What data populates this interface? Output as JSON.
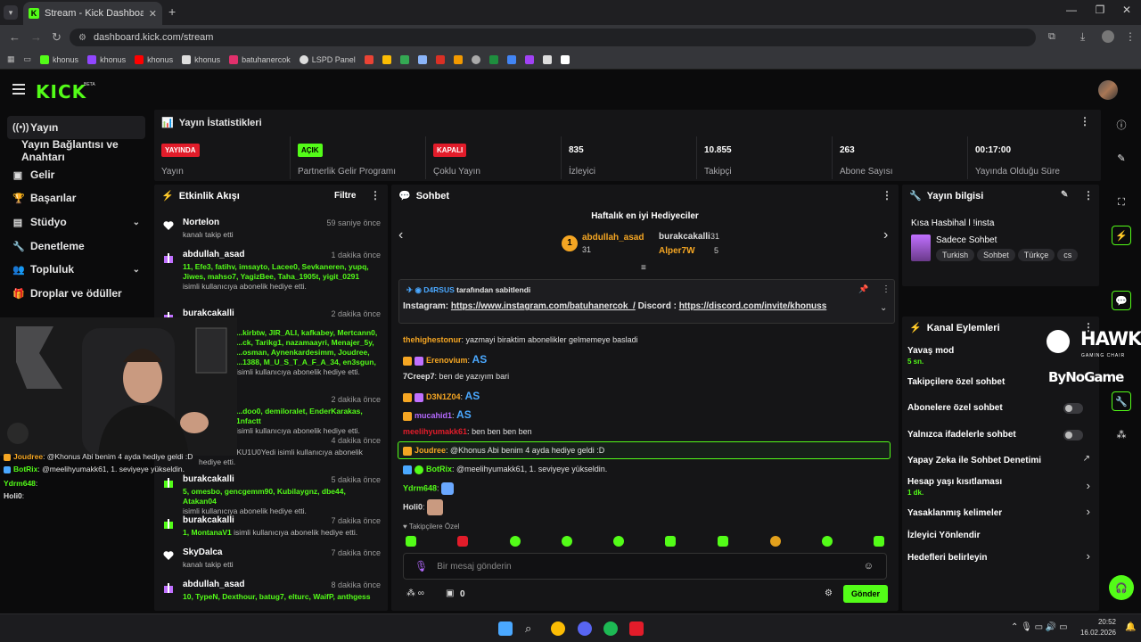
{
  "browser": {
    "tab_title": "Stream - Kick Dashboard",
    "url": "dashboard.kick.com/stream",
    "bookmarks": [
      "khonus",
      "khonus",
      "khonus",
      "khonus",
      "batuhanercok",
      "LSPD Panel"
    ]
  },
  "app": {
    "logo": "KICK",
    "beta": "BETA"
  },
  "sidebar": {
    "items": [
      {
        "label": "Yayın",
        "icon": "broadcast-icon"
      },
      {
        "label": "Yayın Bağlantısı ve Anahtarı",
        "icon": ""
      },
      {
        "label": "Gelir",
        "icon": "money-icon"
      },
      {
        "label": "Başarılar",
        "icon": "trophy-icon"
      },
      {
        "label": "Stüdyo",
        "icon": "studio-icon"
      },
      {
        "label": "Denetleme",
        "icon": "wrench-icon"
      },
      {
        "label": "Topluluk",
        "icon": "people-icon"
      },
      {
        "label": "Droplar ve ödüller",
        "icon": "gift-icon"
      }
    ]
  },
  "stats": {
    "title": "Yayın İstatistikleri",
    "items": [
      {
        "badge": "YAYINDA",
        "label": "Yayın",
        "color": "#e21c2a"
      },
      {
        "badge": "AÇIK",
        "label": "Partnerlik Gelir Programı",
        "color": "#53fc18"
      },
      {
        "badge": "KAPALI",
        "label": "Çoklu Yayın",
        "color": "#e21c2a"
      },
      {
        "value": "835",
        "label": "İzleyici"
      },
      {
        "value": "10.855",
        "label": "Takipçi"
      },
      {
        "value": "263",
        "label": "Abone Sayısı"
      },
      {
        "value": "00:17:00",
        "label": "Yayında Olduğu Süre"
      }
    ]
  },
  "feed": {
    "title": "Etkinlik Akışı",
    "filter": "Filtre",
    "events": [
      {
        "name": "Nortelon",
        "time": "59 saniye önce",
        "names": "",
        "text": "kanalı takip etti",
        "type": "follow"
      },
      {
        "name": "abdullah_asad",
        "time": "1 dakika önce",
        "names": "11, Efe3, fatihv, imsayto, Lacee0, Sevkaneren, yupq, Jiwes, mahso7, YagizBee, Taha_1905t, yigit_0291",
        "text": "isimli kullanıcıya abonelik hediye etti.",
        "type": "gift"
      },
      {
        "name": "burakcakalli",
        "time": "2 dakika önce",
        "names": "...kirbtw, JIR_ALI, kafkabey, Mertcann0, ...ck, Tarikg1, nazamaayri, Menajer_5y, ...osman, Aynenkardesimm, Joudree, ...1388, M_U_S_T_A_F_A_34, en3sgun,",
        "text": "isimli kullanıcıya abonelik hediye etti.",
        "type": "gift"
      },
      {
        "name": "",
        "time": "2 dakika önce",
        "names": "...doo0, demiloralet, EnderKarakas, 1nfactt",
        "text": "isimli kullanıcıya abonelik hediye etti.",
        "type": "gift"
      },
      {
        "name": "",
        "time": "4 dakika önce",
        "names": "",
        "text": "...JUUUDOKU1U0Yedi isimli kullanıcıya abonelik hediye etti.",
        "type": "gift"
      },
      {
        "name": "burakcakalli",
        "time": "5 dakika önce",
        "names": "5, omesbo, gencgemm90, Kubilaygnz, dbe44, Atakan04",
        "text": "isimli kullanıcıya abonelik hediye etti.",
        "type": "gift"
      },
      {
        "name": "burakcakalli",
        "time": "7 dakika önce",
        "names": "1, MontanaV1",
        "text": "isimli kullanıcıya abonelik hediye etti.",
        "type": "gift"
      },
      {
        "name": "SkyDalca",
        "time": "7 dakika önce",
        "names": "",
        "text": "kanalı takip etti",
        "type": "follow"
      },
      {
        "name": "abdullah_asad",
        "time": "8 dakika önce",
        "names": "10, TypeN, Dexthour, batug7, elturc, WaifP, anthgess",
        "text": "",
        "type": "gift"
      }
    ]
  },
  "chat": {
    "title": "Sohbet",
    "weekly": "Haftalık en iyi Hediyeciler",
    "donors": [
      {
        "name": "abdullah_asad",
        "count": "31"
      },
      {
        "name": "burakcakalli",
        "count": "31"
      },
      {
        "name": "Alper7W",
        "count": "5"
      }
    ],
    "pinned_by": "D4RSUS",
    "pinned_suffix": "tarafından sabitlendi",
    "pinned_text_a": "Instagram: ",
    "pinned_link1": "https://www.instagram.com/batuhanercok_/",
    "pinned_text_b": " Discord : ",
    "pinned_link2": "https://discord.com/invite/khonuss",
    "messages": [
      {
        "user": "thehighestonur",
        "text": "yazmayi biraktim abonelikler gelmemeye basladi",
        "color": "#f5a623"
      },
      {
        "user": "Erenovium",
        "text": "AS",
        "color": "#f5a623",
        "emote": true
      },
      {
        "user": "7Creep7",
        "text": "ben de yazıyım bari",
        "color": "#e0e0e0"
      },
      {
        "user": "D3N1Z04",
        "text": "AS",
        "color": "#f5a623",
        "emote": true
      },
      {
        "user": "mucahid1",
        "text": "AS",
        "color": "#b469ff",
        "emote": true
      },
      {
        "user": "meelihyumakk61",
        "text": "ben ben ben ben",
        "color": "#e21c2a"
      },
      {
        "user": "Joudree",
        "text": "@Khonus Abi benim 4 ayda hediye geldi :D",
        "color": "#f5a623"
      },
      {
        "user": "BotRix",
        "text": "@meelihyumakk61, 1. seviyeye yükseldin.",
        "color": "#53fc18"
      },
      {
        "user": "Ydrm648",
        "text": "",
        "color": "#53fc18"
      },
      {
        "user": "Holi0",
        "text": "",
        "color": "#e0e0e0"
      }
    ],
    "followers_only": "Takipçilere Özel",
    "placeholder": "Bir mesaj gönderin",
    "points": "0",
    "send": "Gönder"
  },
  "info": {
    "title": "Yayın bilgisi",
    "stream_title": "Kısa Hasbihal l !insta",
    "category": "Sadece Sohbet",
    "tags": [
      "Turkish",
      "Sohbet",
      "Türkçe",
      "cs"
    ]
  },
  "actions": {
    "title": "Kanal Eylemleri",
    "items": [
      {
        "label": "Yavaş mod",
        "sub": "5 sn."
      },
      {
        "label": "Takipçilere özel sohbet",
        "sub": ""
      },
      {
        "label": "Abonelere özel sohbet",
        "sub": ""
      },
      {
        "label": "Yalnızca ifadelerle sohbet",
        "sub": ""
      },
      {
        "label": "Yapay Zeka ile Sohbet Denetimi",
        "sub": ""
      },
      {
        "label": "Hesap yaşı kısıtlaması",
        "sub": "1 dk."
      },
      {
        "label": "Yasaklanmış kelimeler",
        "sub": ""
      },
      {
        "label": "İzleyici Yönlendir",
        "sub": ""
      },
      {
        "label": "Hedefleri belirleyin",
        "sub": ""
      }
    ]
  },
  "overlay": {
    "hawk": "HAWK",
    "hawk_sub": "GAMING CHAIR",
    "bynogame": "ByNoGame",
    "cam_chat": [
      {
        "user": "Joudree",
        "text": ": @Khonus Abi benim 4 ayda hediye geldi :D"
      },
      {
        "user": "BotRix",
        "text": ": @meelihyumakk61, 1. seviyeye yükseldin."
      },
      {
        "user": "Ydrm648",
        "text": ":"
      },
      {
        "user": "Holi0",
        "text": ":"
      }
    ]
  },
  "taskbar": {
    "time": "20:52",
    "date": "16.02.2026"
  },
  "colors": {
    "accent": "#53fc18",
    "red": "#e21c2a",
    "panel": "#151517",
    "bg": "#0b0b0c"
  }
}
